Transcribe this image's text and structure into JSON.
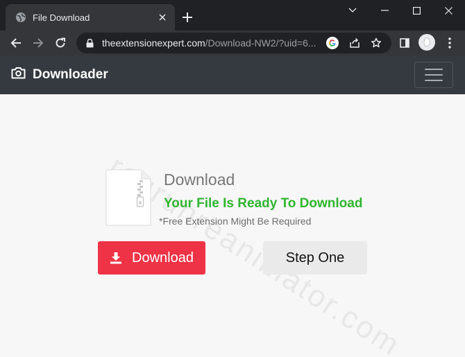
{
  "browser": {
    "tab": {
      "title": "File Download",
      "favicon": "globe-icon"
    },
    "url": {
      "host": "theextensionexpert.com",
      "path": "/Download-NW2/?uid=6..."
    },
    "icons": {
      "back": "arrow-left-icon",
      "forward": "arrow-right-icon",
      "reload": "reload-icon",
      "lock": "lock-icon",
      "google": "google-icon",
      "share": "share-icon",
      "bookmark": "star-icon",
      "side_panel": "side-panel-icon",
      "menu": "kebab-menu-icon"
    }
  },
  "site": {
    "brand": "Downloader",
    "brand_icon": "camera-icon"
  },
  "download": {
    "heading": "Download",
    "ready_text": "Your File Is Ready To Download",
    "note": "*Free Extension Might Be Required",
    "download_button": "Download",
    "step_button": "Step One"
  },
  "watermark": "regrunreanimator.com",
  "colors": {
    "header_bg": "#343a40",
    "ready_green": "#2fb52f",
    "download_red": "#ee3346",
    "step_gray": "#eaeaea"
  }
}
